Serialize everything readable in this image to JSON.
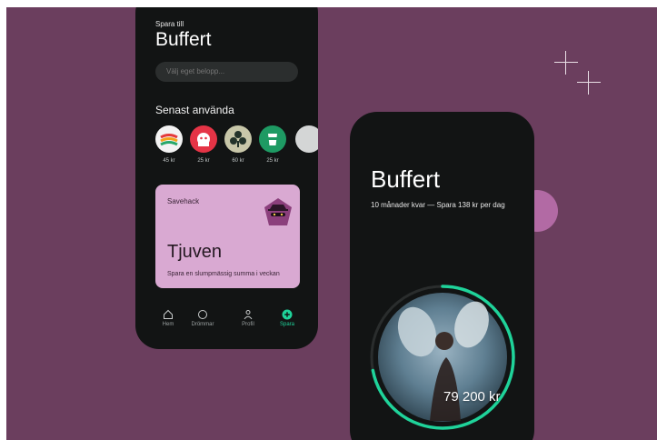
{
  "colors": {
    "background": "#6b3e5e",
    "phone": "#121414",
    "accent": "#1fd39a",
    "card": "#d9a9d2",
    "pink_circle": "#b26aa4"
  },
  "screen1": {
    "kicker": "Spara till",
    "title": "Buffert",
    "input_placeholder": "Välj eget belopp...",
    "section_title": "Senast använda",
    "recent": [
      {
        "icon": "striped-logo-icon",
        "price": "45 kr"
      },
      {
        "icon": "mascot-icon",
        "price": "25 kr"
      },
      {
        "icon": "clover-icon",
        "price": "60 kr"
      },
      {
        "icon": "cup-icon",
        "price": "25 kr"
      }
    ],
    "savehack": {
      "kicker": "Savehack",
      "title": "Tjuven",
      "description": "Spara en slumpmässig summa i veckan",
      "badge_icon": "thief-icon"
    },
    "nav": [
      {
        "label": "Hem",
        "icon": "home-icon"
      },
      {
        "label": "Drömmar",
        "icon": "circle-icon"
      },
      {
        "label": "Profil",
        "icon": "person-icon"
      },
      {
        "label": "Spara",
        "icon": "plus-circle-icon",
        "active": true
      }
    ]
  },
  "screen2": {
    "title": "Buffert",
    "subtitle": "10 månader kvar — Spara 138 kr per dag",
    "amount": "79 200 kr",
    "progress": 0.72
  }
}
